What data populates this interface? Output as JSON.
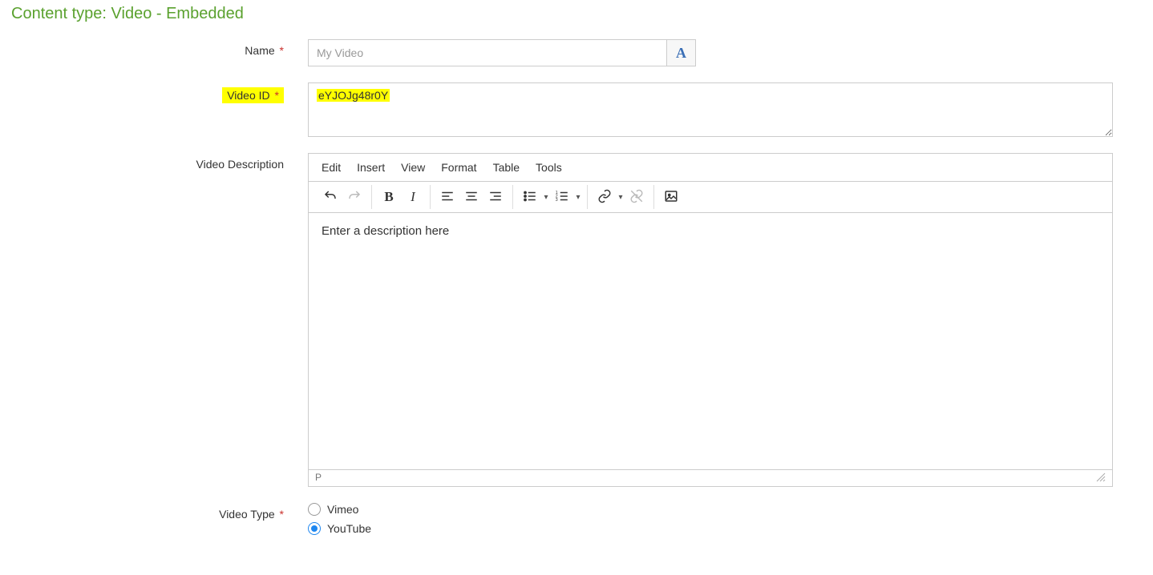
{
  "heading": "Content type: Video - Embedded",
  "fields": {
    "name": {
      "label": "Name",
      "value": "My Video",
      "required": true
    },
    "video_id": {
      "label": "Video ID",
      "value": "eYJOJg48r0Y",
      "required": true
    },
    "description": {
      "label": "Video Description",
      "content": "Enter a description here"
    },
    "video_type": {
      "label": "Video Type",
      "required": true,
      "options": [
        "Vimeo",
        "YouTube"
      ],
      "selected": "YouTube"
    }
  },
  "editor": {
    "menus": [
      "Edit",
      "Insert",
      "View",
      "Format",
      "Table",
      "Tools"
    ],
    "status_path": "P"
  }
}
